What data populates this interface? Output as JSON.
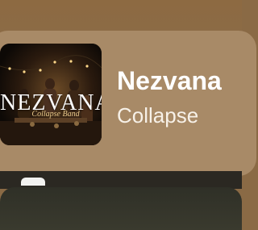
{
  "now_playing": {
    "track_title": "Nezvana",
    "artist": "Collapse",
    "artwork": {
      "title_text": "NEZVANA",
      "subtitle_text": "Collapse Band"
    }
  },
  "colors": {
    "card_background": "#a88a67",
    "page_background": "#8a6a45",
    "bottom_panel": "#34342a"
  }
}
